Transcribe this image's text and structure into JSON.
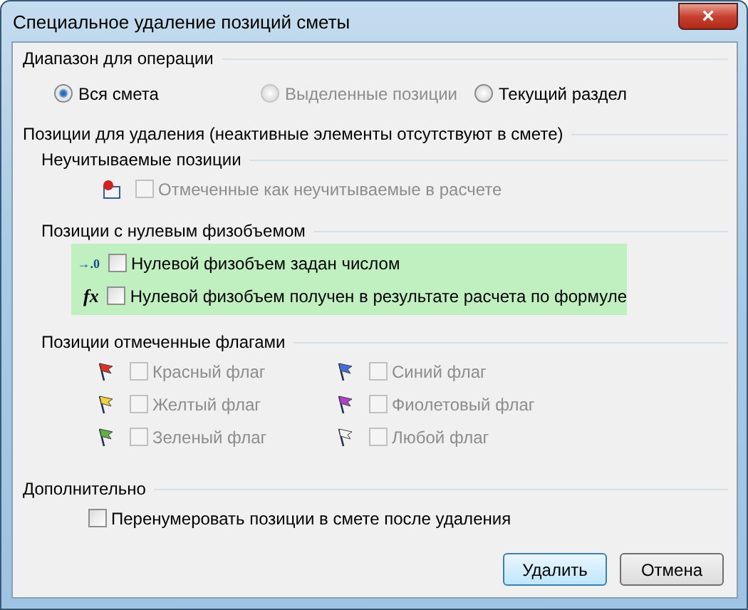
{
  "window": {
    "title": "Специальное удаление позиций сметы",
    "close_glyph": "×"
  },
  "range": {
    "title": "Диапазон для операции",
    "options": [
      {
        "label": "Вся смета",
        "selected": true,
        "disabled": false
      },
      {
        "label": "Выделенные позиции",
        "selected": false,
        "disabled": true
      },
      {
        "label": "Текущий раздел",
        "selected": false,
        "disabled": false
      }
    ]
  },
  "positions": {
    "title": "Позиции для удаления (неактивные элементы отсутствуют в смете)",
    "excluded": {
      "title": "Неучитываемые позиции",
      "items": [
        {
          "label": "Отмеченные как  неучитываемые в расчете",
          "checked": false,
          "disabled": true
        }
      ]
    },
    "zero": {
      "title": "Позиции с нулевым физобъемом",
      "highlighted": true,
      "items": [
        {
          "icon_text": "→.0",
          "label": "Нулевой физобъем задан числом",
          "checked": false,
          "disabled": false
        },
        {
          "icon_text": "fx",
          "label": "Нулевой физобъем получен в результате расчета по формуле",
          "checked": false,
          "disabled": false
        }
      ]
    },
    "flags": {
      "title": "Позиции отмеченные флагами",
      "items": [
        {
          "label": "Красный флаг",
          "color": "#e03020",
          "checked": false,
          "disabled": true
        },
        {
          "label": "Синий флаг",
          "color": "#4070d8",
          "checked": false,
          "disabled": true
        },
        {
          "label": "Желтый флаг",
          "color": "#f0d040",
          "checked": false,
          "disabled": true
        },
        {
          "label": "Фиолетовый флаг",
          "color": "#b040c8",
          "checked": false,
          "disabled": true
        },
        {
          "label": "Зеленый флаг",
          "color": "#60b040",
          "checked": false,
          "disabled": true
        },
        {
          "label": "Любой флаг",
          "color": "#f4f4f4",
          "checked": false,
          "disabled": true
        }
      ]
    }
  },
  "extra": {
    "title": "Дополнительно",
    "items": [
      {
        "label": "Перенумеровать позиции в смете после удаления",
        "checked": false,
        "disabled": false
      }
    ]
  },
  "buttons": [
    {
      "label": "Удалить",
      "default": true
    },
    {
      "label": "Отмена",
      "default": false
    }
  ]
}
